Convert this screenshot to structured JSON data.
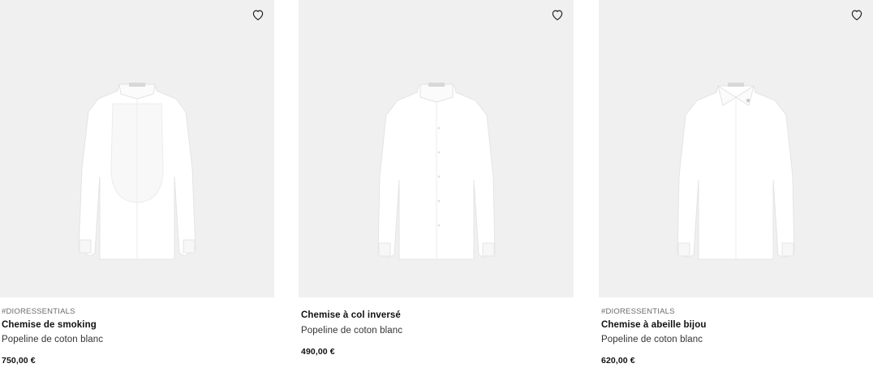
{
  "products": [
    {
      "tag": "#DIORESSENTIALS",
      "name": "Chemise de smoking",
      "description": "Popeline de coton blanc",
      "price": "750,00 €",
      "icon": "heart-outline-icon"
    },
    {
      "tag": "",
      "name": "Chemise à col inversé",
      "description": "Popeline de coton blanc",
      "price": "490,00 €",
      "icon": "heart-outline-icon"
    },
    {
      "tag": "#DIORESSENTIALS",
      "name": "Chemise à abeille bijou",
      "description": "Popeline de coton blanc",
      "price": "620,00 €",
      "icon": "heart-outline-icon"
    }
  ],
  "colors": {
    "image_background": "#f0f0f0",
    "text_primary": "#111111",
    "text_secondary": "#6b6b6b"
  }
}
